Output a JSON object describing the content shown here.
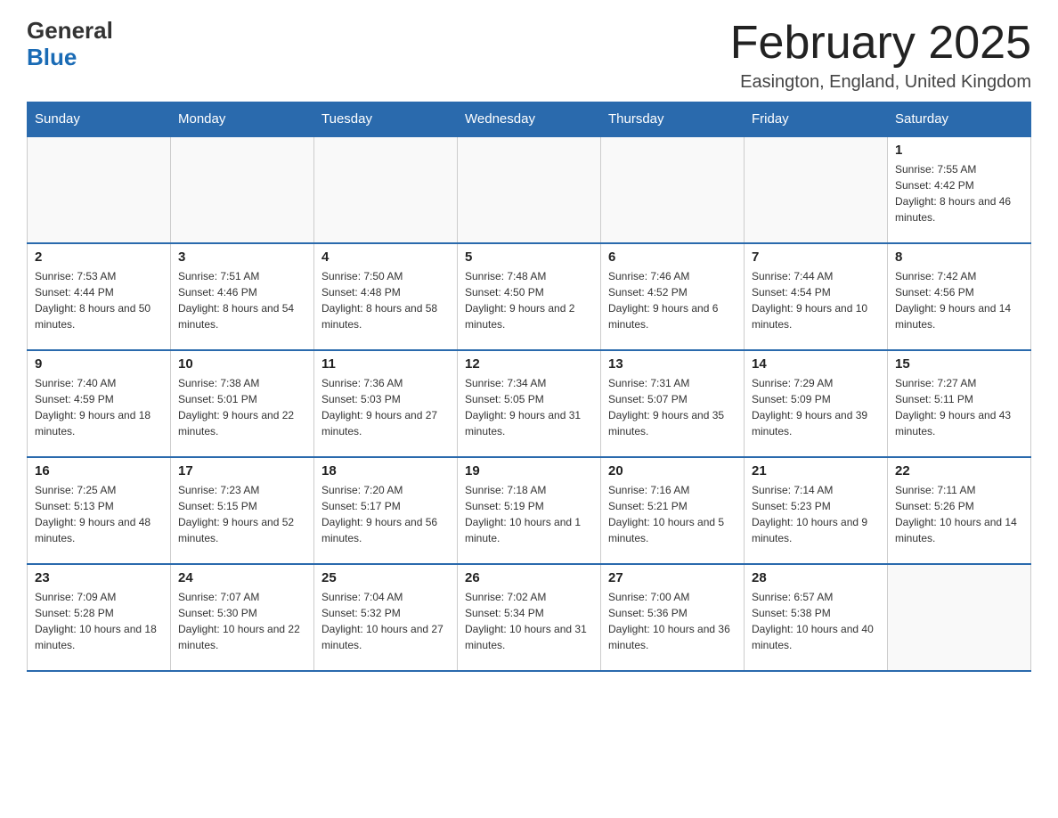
{
  "header": {
    "logo_general": "General",
    "logo_blue": "Blue",
    "month_title": "February 2025",
    "location": "Easington, England, United Kingdom"
  },
  "weekdays": [
    "Sunday",
    "Monday",
    "Tuesday",
    "Wednesday",
    "Thursday",
    "Friday",
    "Saturday"
  ],
  "weeks": [
    [
      {
        "day": "",
        "sunrise": "",
        "sunset": "",
        "daylight": ""
      },
      {
        "day": "",
        "sunrise": "",
        "sunset": "",
        "daylight": ""
      },
      {
        "day": "",
        "sunrise": "",
        "sunset": "",
        "daylight": ""
      },
      {
        "day": "",
        "sunrise": "",
        "sunset": "",
        "daylight": ""
      },
      {
        "day": "",
        "sunrise": "",
        "sunset": "",
        "daylight": ""
      },
      {
        "day": "",
        "sunrise": "",
        "sunset": "",
        "daylight": ""
      },
      {
        "day": "1",
        "sunrise": "Sunrise: 7:55 AM",
        "sunset": "Sunset: 4:42 PM",
        "daylight": "Daylight: 8 hours and 46 minutes."
      }
    ],
    [
      {
        "day": "2",
        "sunrise": "Sunrise: 7:53 AM",
        "sunset": "Sunset: 4:44 PM",
        "daylight": "Daylight: 8 hours and 50 minutes."
      },
      {
        "day": "3",
        "sunrise": "Sunrise: 7:51 AM",
        "sunset": "Sunset: 4:46 PM",
        "daylight": "Daylight: 8 hours and 54 minutes."
      },
      {
        "day": "4",
        "sunrise": "Sunrise: 7:50 AM",
        "sunset": "Sunset: 4:48 PM",
        "daylight": "Daylight: 8 hours and 58 minutes."
      },
      {
        "day": "5",
        "sunrise": "Sunrise: 7:48 AM",
        "sunset": "Sunset: 4:50 PM",
        "daylight": "Daylight: 9 hours and 2 minutes."
      },
      {
        "day": "6",
        "sunrise": "Sunrise: 7:46 AM",
        "sunset": "Sunset: 4:52 PM",
        "daylight": "Daylight: 9 hours and 6 minutes."
      },
      {
        "day": "7",
        "sunrise": "Sunrise: 7:44 AM",
        "sunset": "Sunset: 4:54 PM",
        "daylight": "Daylight: 9 hours and 10 minutes."
      },
      {
        "day": "8",
        "sunrise": "Sunrise: 7:42 AM",
        "sunset": "Sunset: 4:56 PM",
        "daylight": "Daylight: 9 hours and 14 minutes."
      }
    ],
    [
      {
        "day": "9",
        "sunrise": "Sunrise: 7:40 AM",
        "sunset": "Sunset: 4:59 PM",
        "daylight": "Daylight: 9 hours and 18 minutes."
      },
      {
        "day": "10",
        "sunrise": "Sunrise: 7:38 AM",
        "sunset": "Sunset: 5:01 PM",
        "daylight": "Daylight: 9 hours and 22 minutes."
      },
      {
        "day": "11",
        "sunrise": "Sunrise: 7:36 AM",
        "sunset": "Sunset: 5:03 PM",
        "daylight": "Daylight: 9 hours and 27 minutes."
      },
      {
        "day": "12",
        "sunrise": "Sunrise: 7:34 AM",
        "sunset": "Sunset: 5:05 PM",
        "daylight": "Daylight: 9 hours and 31 minutes."
      },
      {
        "day": "13",
        "sunrise": "Sunrise: 7:31 AM",
        "sunset": "Sunset: 5:07 PM",
        "daylight": "Daylight: 9 hours and 35 minutes."
      },
      {
        "day": "14",
        "sunrise": "Sunrise: 7:29 AM",
        "sunset": "Sunset: 5:09 PM",
        "daylight": "Daylight: 9 hours and 39 minutes."
      },
      {
        "day": "15",
        "sunrise": "Sunrise: 7:27 AM",
        "sunset": "Sunset: 5:11 PM",
        "daylight": "Daylight: 9 hours and 43 minutes."
      }
    ],
    [
      {
        "day": "16",
        "sunrise": "Sunrise: 7:25 AM",
        "sunset": "Sunset: 5:13 PM",
        "daylight": "Daylight: 9 hours and 48 minutes."
      },
      {
        "day": "17",
        "sunrise": "Sunrise: 7:23 AM",
        "sunset": "Sunset: 5:15 PM",
        "daylight": "Daylight: 9 hours and 52 minutes."
      },
      {
        "day": "18",
        "sunrise": "Sunrise: 7:20 AM",
        "sunset": "Sunset: 5:17 PM",
        "daylight": "Daylight: 9 hours and 56 minutes."
      },
      {
        "day": "19",
        "sunrise": "Sunrise: 7:18 AM",
        "sunset": "Sunset: 5:19 PM",
        "daylight": "Daylight: 10 hours and 1 minute."
      },
      {
        "day": "20",
        "sunrise": "Sunrise: 7:16 AM",
        "sunset": "Sunset: 5:21 PM",
        "daylight": "Daylight: 10 hours and 5 minutes."
      },
      {
        "day": "21",
        "sunrise": "Sunrise: 7:14 AM",
        "sunset": "Sunset: 5:23 PM",
        "daylight": "Daylight: 10 hours and 9 minutes."
      },
      {
        "day": "22",
        "sunrise": "Sunrise: 7:11 AM",
        "sunset": "Sunset: 5:26 PM",
        "daylight": "Daylight: 10 hours and 14 minutes."
      }
    ],
    [
      {
        "day": "23",
        "sunrise": "Sunrise: 7:09 AM",
        "sunset": "Sunset: 5:28 PM",
        "daylight": "Daylight: 10 hours and 18 minutes."
      },
      {
        "day": "24",
        "sunrise": "Sunrise: 7:07 AM",
        "sunset": "Sunset: 5:30 PM",
        "daylight": "Daylight: 10 hours and 22 minutes."
      },
      {
        "day": "25",
        "sunrise": "Sunrise: 7:04 AM",
        "sunset": "Sunset: 5:32 PM",
        "daylight": "Daylight: 10 hours and 27 minutes."
      },
      {
        "day": "26",
        "sunrise": "Sunrise: 7:02 AM",
        "sunset": "Sunset: 5:34 PM",
        "daylight": "Daylight: 10 hours and 31 minutes."
      },
      {
        "day": "27",
        "sunrise": "Sunrise: 7:00 AM",
        "sunset": "Sunset: 5:36 PM",
        "daylight": "Daylight: 10 hours and 36 minutes."
      },
      {
        "day": "28",
        "sunrise": "Sunrise: 6:57 AM",
        "sunset": "Sunset: 5:38 PM",
        "daylight": "Daylight: 10 hours and 40 minutes."
      },
      {
        "day": "",
        "sunrise": "",
        "sunset": "",
        "daylight": ""
      }
    ]
  ]
}
